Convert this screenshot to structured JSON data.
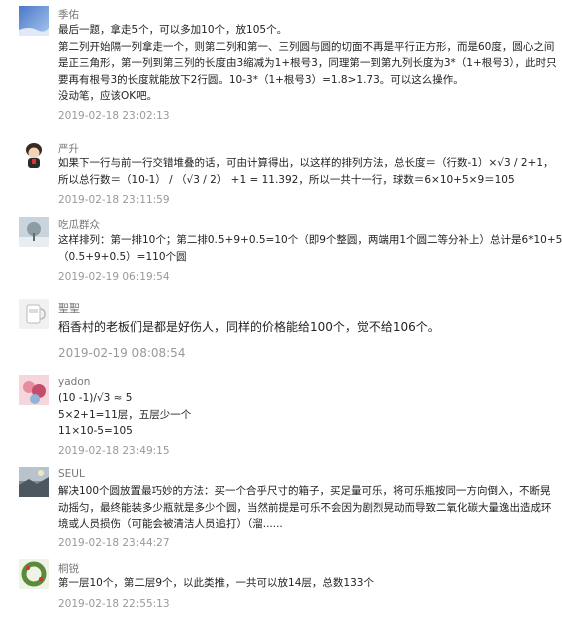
{
  "comments": [
    {
      "author": "季佑",
      "avatar_icon": "sky-avatar-icon",
      "lines": [
        "最后一题，拿走5个，可以多加10个，放105个。",
        "第二列开始隔一列拿走一个，则第二列和第一、三列圆与圆的切面不再是平行正方形，而是60度，圆心之间",
        "是正三角形，第一列到第三列的长度由3缩减为1+根号3，同理第一到第九列长度为3*（1+根号3），此时只",
        "要再有根号3的长度就能放下2行圆。10-3*（1+根号3）=1.8>1.73。可以这么操作。",
        "没动笔，应该OK吧。"
      ],
      "time": "2019-02-18 23:02:13"
    },
    {
      "author": "严升",
      "avatar_icon": "cartoon-character-avatar-icon",
      "lines": [
        "如果下一行与前一行交错堆叠的话，可由计算得出，以这样的排列方法，总长度＝（行数-1）×√3 / 2+1，",
        "所以总行数＝（10-1） / （√3 / 2） +1 = 11.392，所以一共十一行，球数＝6×10+5×9＝105"
      ],
      "time": "2019-02-18 23:11:59"
    },
    {
      "author": "吃瓜群众",
      "avatar_icon": "snowy-tree-avatar-icon",
      "lines": [
        "这样排列：第一排10个；第二排0.5+9+0.5=10个（即9个整圆，两端用1个圆二等分补上）总计是6*10+5*",
        "（0.5+9+0.5）=110个圆"
      ],
      "time": "2019-02-19 06:19:54"
    },
    {
      "author": "聖聖",
      "avatar_icon": "mug-avatar-icon",
      "lines": [
        "稻香村的老板们是都是好伤人，同样的价格能给100个，觉不给106个。"
      ],
      "time": "2019-02-19 08:08:54"
    },
    {
      "author": "yadon",
      "avatar_icon": "pink-character-avatar-icon",
      "lines": [
        "(10 -1)/√3 ≈ 5",
        "5×2+1=11层，五层少一个",
        "11×10-5=105"
      ],
      "time": "2019-02-18 23:49:15"
    },
    {
      "author": "SEUL",
      "avatar_icon": "landscape-avatar-icon",
      "lines": [
        "解决100个圆放置最巧妙的方法：买一个合乎尺寸的箱子，买足量可乐，将可乐瓶按同一方向倒入，不断晃",
        "动摇匀，最终能装多少瓶就是多少个圆，当然前提是可乐不会因为剧烈晃动而导致二氧化碳大量逸出造成环",
        "境或人员损伤（可能会被清洁人员追打）（溜......"
      ],
      "time": "2019-02-18 23:44:27"
    },
    {
      "author": "桐锐",
      "avatar_icon": "wreath-avatar-icon",
      "lines": [
        "第一层10个，第二层9个，以此类推，一共可以放14层，总数133个"
      ],
      "time": "2019-02-18 22:55:13"
    }
  ]
}
